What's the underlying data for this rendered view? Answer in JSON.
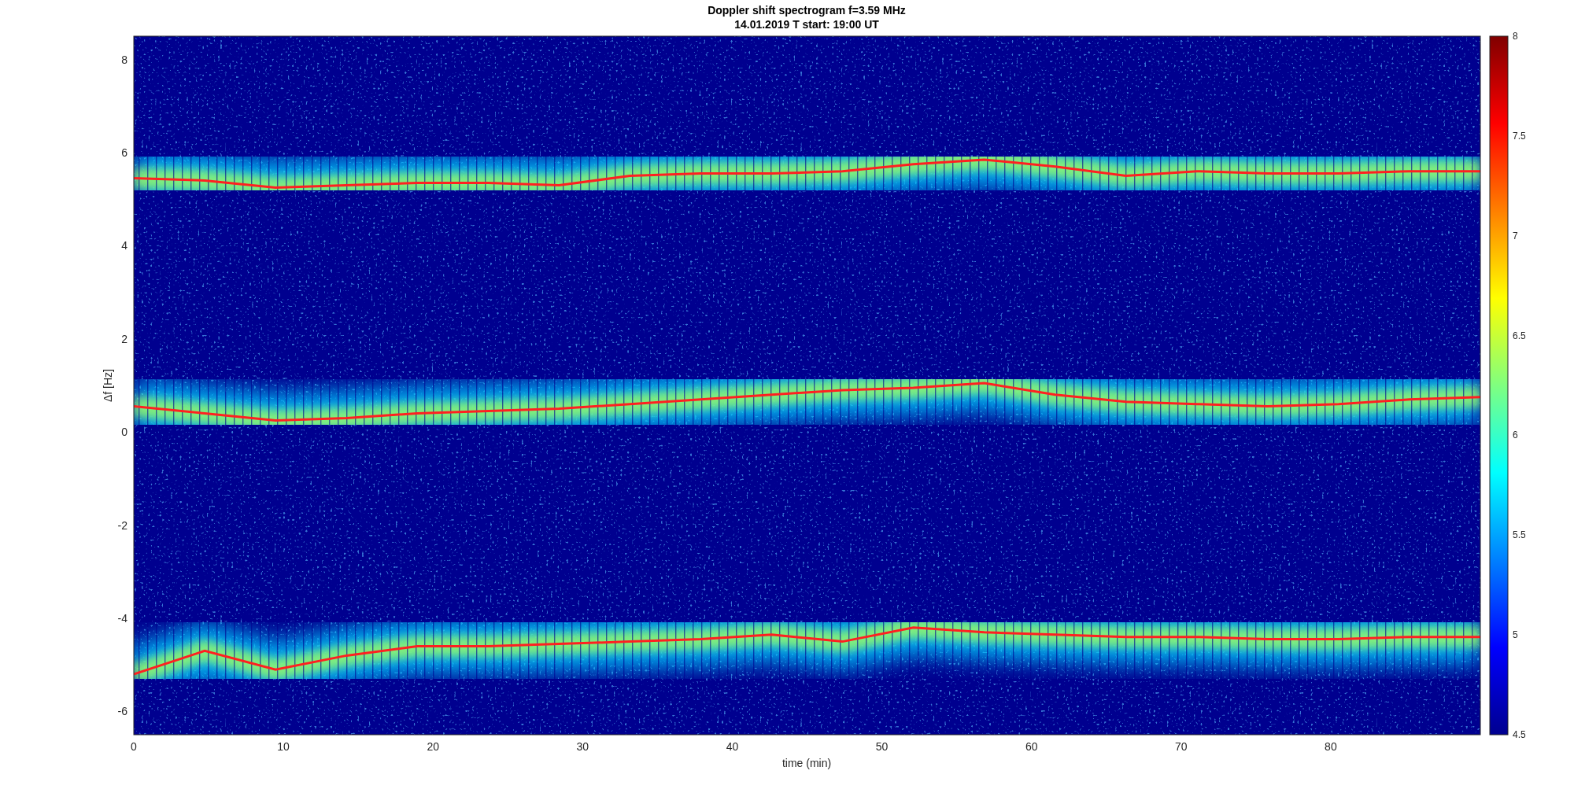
{
  "figure": {
    "title_lines": [
      "Doppler shift spectrogram f=3.59 MHz",
      "14.01.2019   T start: 19:00 UT"
    ]
  },
  "axes": {
    "xlabel": "time (min)",
    "ylabel": "Δf [Hz]",
    "xticks": [
      "0",
      "10",
      "20",
      "30",
      "40",
      "50",
      "60",
      "70",
      "80"
    ],
    "yticks": [
      "8",
      "6",
      "4",
      "2",
      "0",
      "-2",
      "-4",
      "-6"
    ]
  },
  "colorbar": {
    "ticks": [
      "8",
      "7.5",
      "7",
      "6.5",
      "6",
      "5.5",
      "5",
      "4.5"
    ]
  }
}
